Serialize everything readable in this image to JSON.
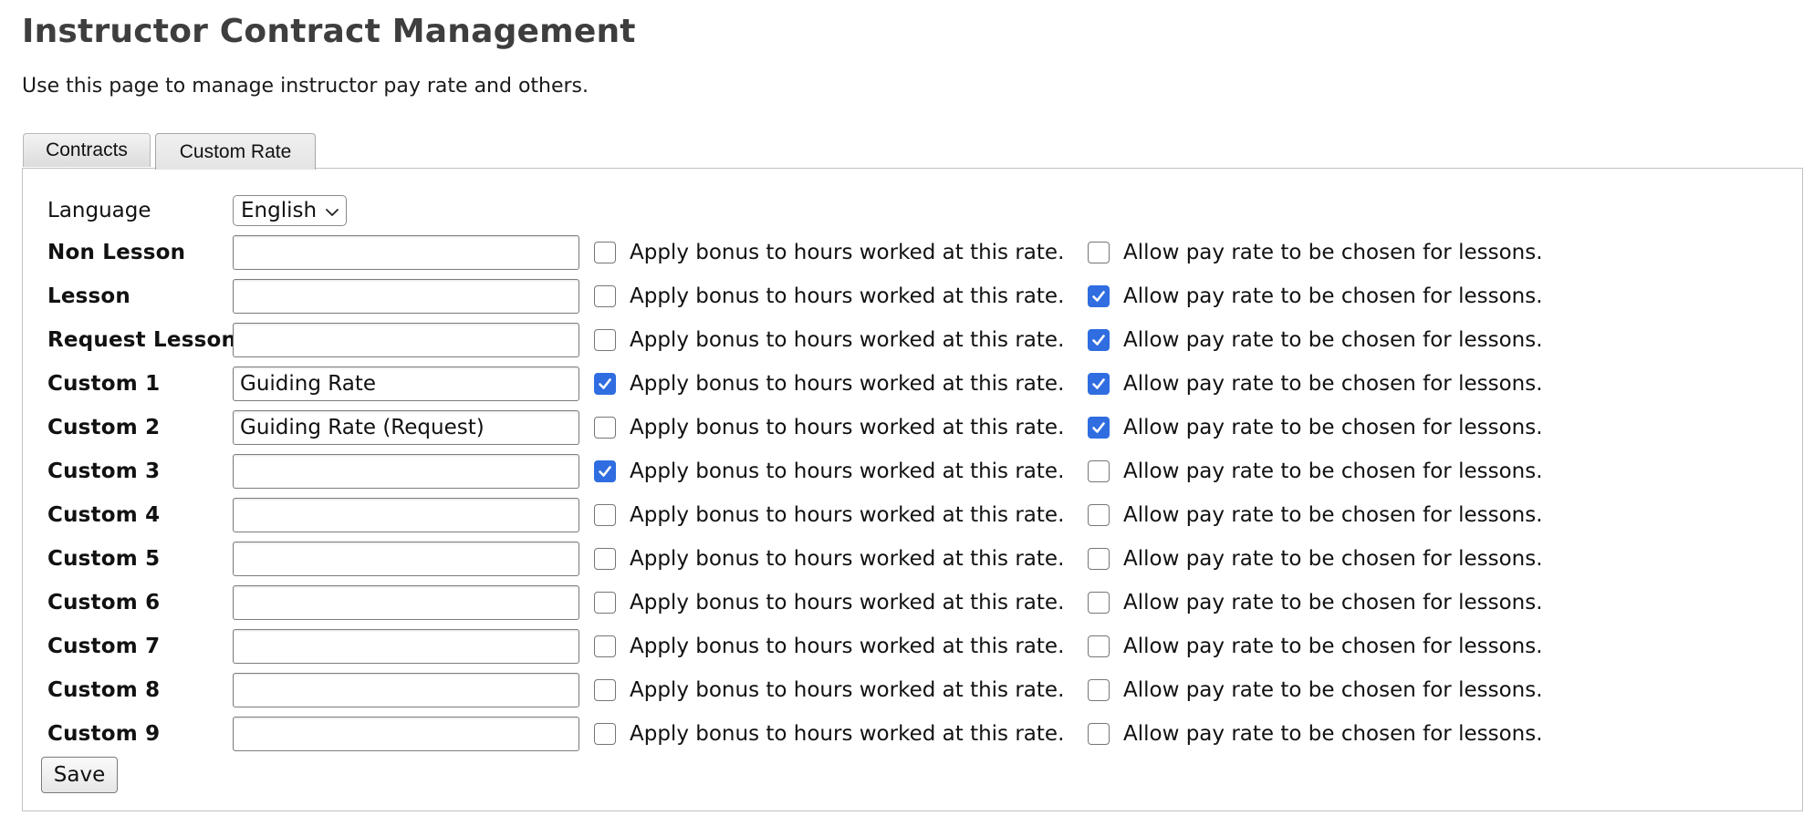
{
  "page": {
    "title": "Instructor Contract Management",
    "description": "Use this page to manage instructor pay rate and others."
  },
  "tabs": [
    {
      "label": "Contracts",
      "active": false
    },
    {
      "label": "Custom Rate",
      "active": true
    }
  ],
  "language": {
    "label": "Language",
    "selected": "English"
  },
  "checkbox_texts": {
    "bonus": "Apply bonus to hours worked at this rate.",
    "allow": "Allow pay rate to be chosen for lessons."
  },
  "rates": [
    {
      "label": "Non Lesson",
      "value": "",
      "bonus": false,
      "allow": false
    },
    {
      "label": "Lesson",
      "value": "",
      "bonus": false,
      "allow": true
    },
    {
      "label": "Request Lesson",
      "value": "",
      "bonus": false,
      "allow": true
    },
    {
      "label": "Custom 1",
      "value": "Guiding Rate",
      "bonus": true,
      "allow": true
    },
    {
      "label": "Custom 2",
      "value": "Guiding Rate (Request)",
      "bonus": false,
      "allow": true
    },
    {
      "label": "Custom 3",
      "value": "",
      "bonus": true,
      "allow": false
    },
    {
      "label": "Custom 4",
      "value": "",
      "bonus": false,
      "allow": false
    },
    {
      "label": "Custom 5",
      "value": "",
      "bonus": false,
      "allow": false
    },
    {
      "label": "Custom 6",
      "value": "",
      "bonus": false,
      "allow": false
    },
    {
      "label": "Custom 7",
      "value": "",
      "bonus": false,
      "allow": false
    },
    {
      "label": "Custom 8",
      "value": "",
      "bonus": false,
      "allow": false
    },
    {
      "label": "Custom 9",
      "value": "",
      "bonus": false,
      "allow": false
    }
  ],
  "save_label": "Save",
  "colors": {
    "checkbox_checked": "#2f6de1",
    "title": "#3e3e3e"
  }
}
